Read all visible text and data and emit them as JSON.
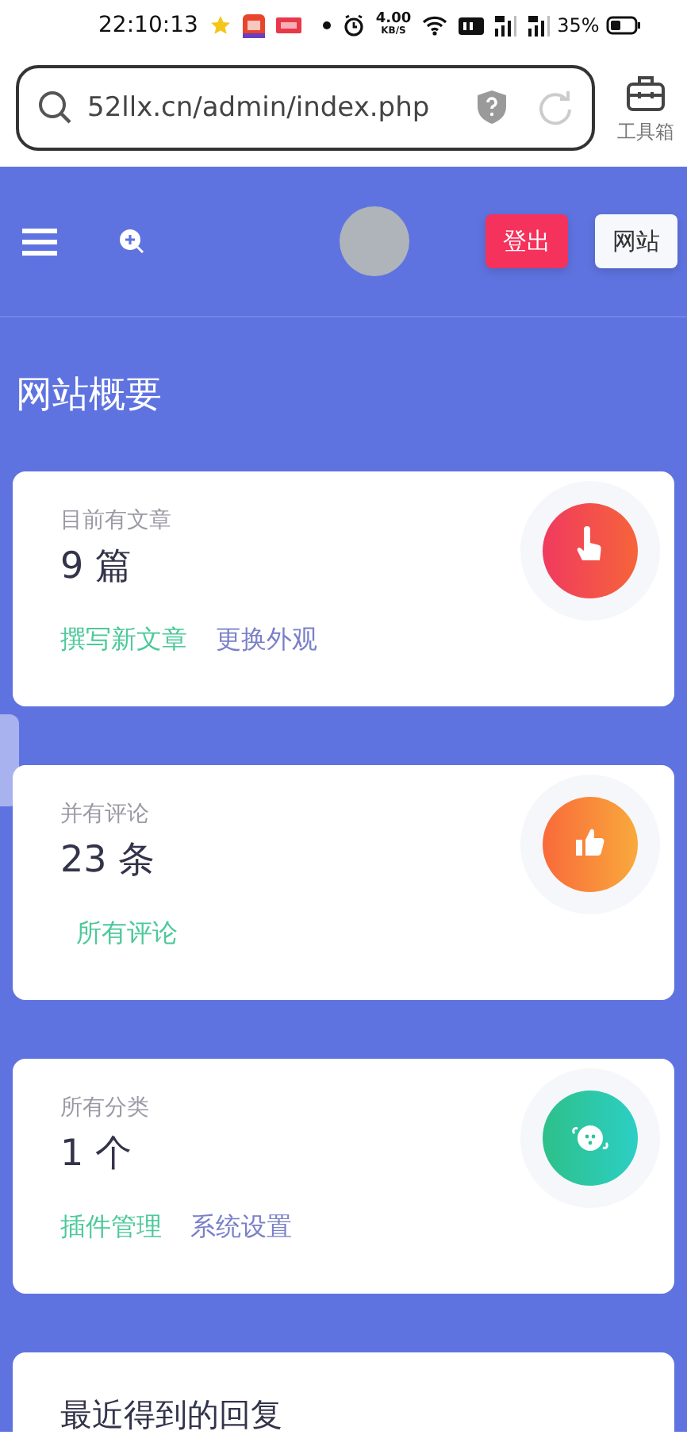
{
  "status_bar": {
    "time": "22:10:13",
    "net_speed": "4.00",
    "net_unit": "KB/S",
    "battery": "35%"
  },
  "browser": {
    "url": "52llx.cn/admin/index.php",
    "toolbox_label": "工具箱"
  },
  "header": {
    "logout": "登出",
    "site": "网站"
  },
  "page_title": "网站概要",
  "cards": [
    {
      "label": "目前有文章",
      "count": "9 篇",
      "links": [
        {
          "text": "撰写新文章",
          "color": "#4cc99a"
        },
        {
          "text": "更换外观",
          "color": "#7a80c8"
        }
      ]
    },
    {
      "label": "并有评论",
      "count": "23 条",
      "links": [
        {
          "text": "所有评论",
          "color": "#4cc99a"
        }
      ]
    },
    {
      "label": "所有分类",
      "count": "1 个",
      "links": [
        {
          "text": "插件管理",
          "color": "#4cc99a"
        },
        {
          "text": "系统设置",
          "color": "#7a80c8"
        }
      ]
    }
  ],
  "recent": {
    "title": "最近得到的回复"
  }
}
